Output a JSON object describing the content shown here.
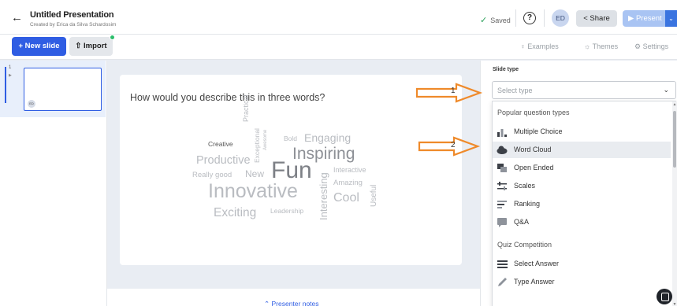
{
  "header": {
    "title": "Untitled Presentation",
    "subtitle": "Created by Erica da Silva Schardosim",
    "saved": "Saved",
    "help": "?",
    "avatar": "ED",
    "share": "Share",
    "present": "Present"
  },
  "toolbar": {
    "new_slide": "+ New slide",
    "import": "Import",
    "examples": "Examples",
    "themes": "Themes",
    "settings": "Settings"
  },
  "slides": [
    {
      "number": "1",
      "avatar": "ED"
    }
  ],
  "canvas": {
    "question": "How would you describe this in three words?",
    "word_cloud": {
      "practical": "Practical",
      "exceptional": "Exceptional",
      "awesome": "Awesome",
      "bold": "Bold",
      "engaging": "Engaging",
      "creative": "Creative",
      "inspiring": "Inspiring",
      "productive": "Productive",
      "interactive": "Interactive",
      "really_good": "Really good",
      "new": "New",
      "fun": "Fun",
      "amazing": "Amazing",
      "innovative": "Innovative",
      "cool": "Cool",
      "interesting": "Interesting",
      "useful": "Useful",
      "exciting": "Exciting",
      "leadership": "Leadership"
    },
    "presenter_notes": "Presenter notes"
  },
  "right_panel": {
    "title": "Slide type",
    "select_placeholder": "Select type",
    "section_popular": "Popular question types",
    "popular_items": [
      {
        "label": "Multiple Choice",
        "icon": "bar-chart-icon"
      },
      {
        "label": "Word Cloud",
        "icon": "cloud-icon"
      },
      {
        "label": "Open Ended",
        "icon": "speech-bubbles-icon"
      },
      {
        "label": "Scales",
        "icon": "sliders-icon"
      },
      {
        "label": "Ranking",
        "icon": "ranking-icon"
      },
      {
        "label": "Q&A",
        "icon": "chat-icon"
      }
    ],
    "section_quiz": "Quiz Competition",
    "quiz_items": [
      {
        "label": "Select Answer",
        "icon": "list-icon"
      },
      {
        "label": "Type Answer",
        "icon": "pencil-icon"
      }
    ]
  },
  "annotations": {
    "one": "1",
    "two": "2",
    "arrow_color": "#ef8a2a"
  },
  "colors": {
    "accent": "#2f5de3",
    "saved_check": "#2aa05a"
  }
}
